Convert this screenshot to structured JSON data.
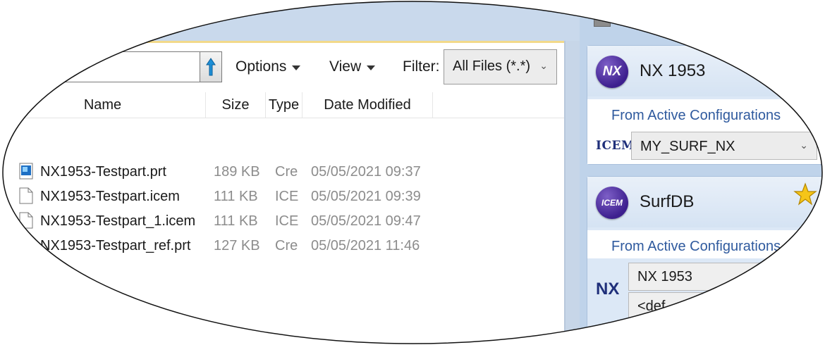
{
  "toolbar": {
    "options_label": "Options",
    "view_label": "View",
    "filter_label": "Filter:",
    "filter_value": "All Files (*.*)"
  },
  "columns": {
    "name": "Name",
    "size": "Size",
    "type": "Type",
    "date": "Date Modified"
  },
  "files": [
    {
      "name": "NX1953-Testpart.prt",
      "size": "189 KB",
      "type": "Cre",
      "date": "05/05/2021 09:37",
      "icon": "prt-file-icon"
    },
    {
      "name": "NX1953-Testpart.icem",
      "size": "111 KB",
      "type": "ICE",
      "date": "05/05/2021 09:39",
      "icon": "blank-file-icon"
    },
    {
      "name": "NX1953-Testpart_1.icem",
      "size": "111 KB",
      "type": "ICE",
      "date": "05/05/2021 09:47",
      "icon": "blank-file-icon"
    },
    {
      "name": "NX1953-Testpart_ref.prt",
      "size": "127 KB",
      "type": "Cre",
      "date": "05/05/2021 11:46",
      "icon": "prt-file-icon"
    }
  ],
  "panel": {
    "nx_card": {
      "logo_text": "NX",
      "title": "NX 1953",
      "subtitle": "From Active Configurations",
      "config_prefix": "ICEM",
      "config_value": "MY_SURF_NX"
    },
    "surf_card": {
      "logo_text": "ICEM",
      "title": "SurfDB",
      "subtitle": "From Active Configurations",
      "config_prefix": "NX",
      "field1": "NX 1953",
      "field2": "<def"
    }
  },
  "colors": {
    "accent_blue": "#2f5a9e",
    "logo_purple": "#3d1f8e",
    "star_gold": "#f5c518"
  }
}
